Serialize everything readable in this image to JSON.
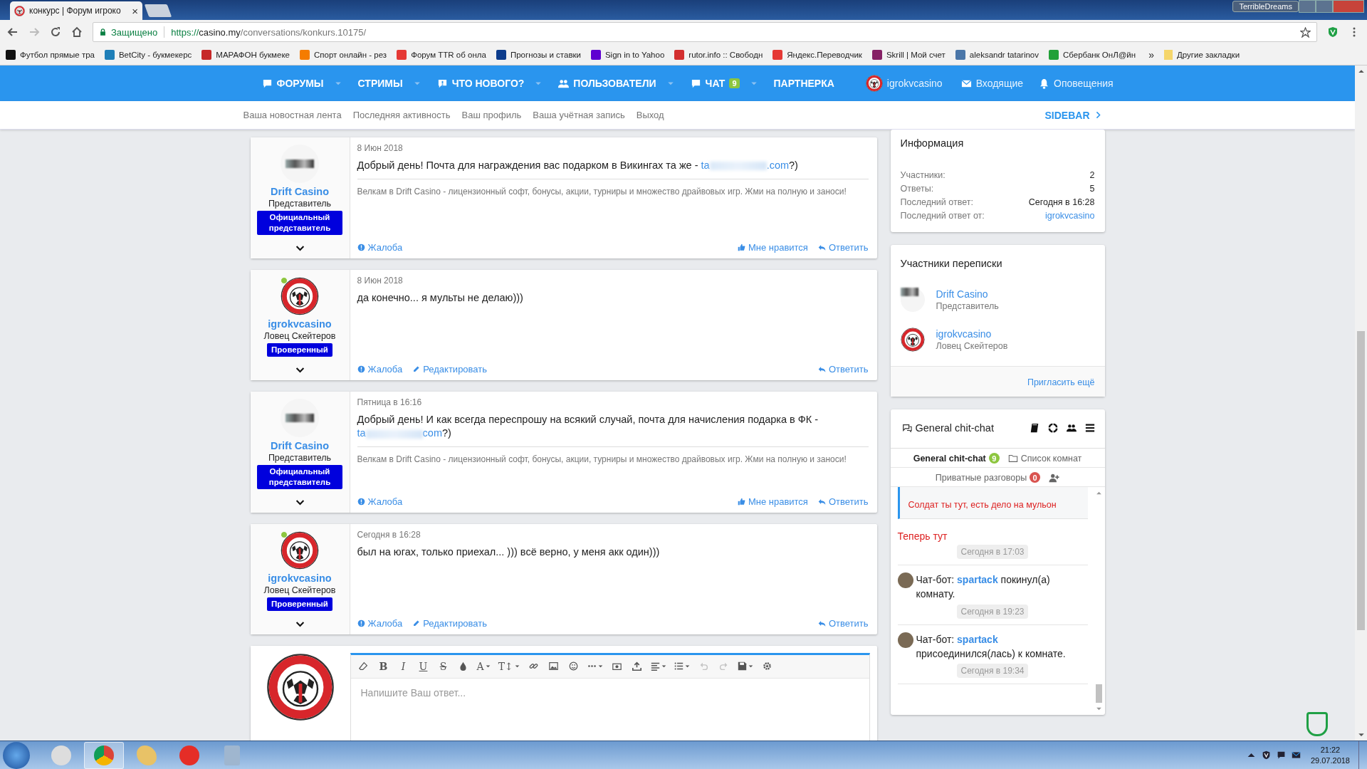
{
  "browser": {
    "tab": {
      "title": "конкурс | Форум игроко",
      "close": "×"
    },
    "user_label": "TerribleDreams",
    "security": "Защищено",
    "url": {
      "scheme": "https://",
      "host": "casino.my",
      "path": "/conversations/konkurs.10175/"
    }
  },
  "bookmarks": [
    {
      "label": "Футбол прямые тра",
      "color": "#111111"
    },
    {
      "label": "BetCity - букмекерс",
      "color": "#1f7fb8"
    },
    {
      "label": "МАРАФОН букмеке",
      "color": "#c62828"
    },
    {
      "label": "Спорт онлайн - рез",
      "color": "#f57c00"
    },
    {
      "label": "Форум TTR об онла",
      "color": "#e53935"
    },
    {
      "label": "Прогнозы и ставки",
      "color": "#0d3c8c"
    },
    {
      "label": "Sign in to Yahoo",
      "color": "#5f01d1"
    },
    {
      "label": "rutor.info :: Свободн",
      "color": "#d32f2f"
    },
    {
      "label": "Яндекс.Переводчик",
      "color": "#e53935"
    },
    {
      "label": "Skrill | Мой счет",
      "color": "#862165"
    },
    {
      "label": "aleksandr tatarinov",
      "color": "#4a76a8"
    },
    {
      "label": "Сбербанк ОнЛ@йн",
      "color": "#21a038"
    }
  ],
  "bookmarks_more": "»",
  "other_bookmarks": "Другие закладки",
  "nav": {
    "items": [
      {
        "label": "ФОРУМЫ",
        "caret": true
      },
      {
        "label": "СТРИМЫ",
        "caret": true
      },
      {
        "label": "ЧТО НОВОГО?",
        "caret": true
      },
      {
        "label": "ПОЛЬЗОВАТЕЛИ",
        "caret": true
      },
      {
        "label": "ЧАТ",
        "badge": "9",
        "caret": true
      },
      {
        "label": "ПАРТНЕРКА",
        "caret": false
      }
    ],
    "user": "igrokvcasino",
    "inbox": "Входящие",
    "alerts": "Оповещения"
  },
  "subnav": {
    "links": [
      "Ваша новостная лента",
      "Последняя активность",
      "Ваш профиль",
      "Ваша учётная запись",
      "Выход"
    ],
    "sidebar_toggle": "SIDEBAR"
  },
  "posts": [
    {
      "author": "Drift Casino",
      "kind": "representative",
      "online": false,
      "role": "Представитель",
      "badge": "Официальный представитель",
      "date": "8 Июн 2018",
      "text": "Добрый день! Почта для награждения вас подарком в Викингах та же - ",
      "link_start": "ta",
      "link_end": ".com",
      "tail": "?)",
      "signature": "Велкам в Drift Casino - лицензионный софт, бонусы, акции, турниры и множество драйвовых игр. Жми на полную и заноси!",
      "actions": [
        {
          "kind": "report",
          "label": "Жалоба"
        },
        {
          "kind": "like",
          "label": "Мне нравится"
        },
        {
          "kind": "reply",
          "label": "Ответить"
        }
      ]
    },
    {
      "author": "igrokvcasino",
      "kind": "member",
      "online": true,
      "role": "Ловец Скейтеров",
      "badge": "Проверенный",
      "date": "8 Июн 2018",
      "text": "да конечно... я мульты не делаю)))",
      "actions": [
        {
          "kind": "report",
          "label": "Жалоба"
        },
        {
          "kind": "edit",
          "label": "Редактировать"
        },
        {
          "kind": "reply",
          "label": "Ответить"
        }
      ]
    },
    {
      "author": "Drift Casino",
      "kind": "representative",
      "online": false,
      "role": "Представитель",
      "badge": "Официальный представитель",
      "date": "Пятница в 16:16",
      "text": "Добрый день! И как всегда переспрошу на всякий случай, почта для начисления подарка в ФК - ",
      "link_start": "ta",
      "link_end": "com",
      "tail": "?)",
      "signature": "Велкам в Drift Casino - лицензионный софт, бонусы, акции, турниры и множество драйвовых игр. Жми на полную и заноси!",
      "actions": [
        {
          "kind": "report",
          "label": "Жалоба"
        },
        {
          "kind": "like",
          "label": "Мне нравится"
        },
        {
          "kind": "reply",
          "label": "Ответить"
        }
      ]
    },
    {
      "author": "igrokvcasino",
      "kind": "member",
      "online": true,
      "role": "Ловец Скейтеров",
      "badge": "Проверенный",
      "date": "Сегодня в 16:28",
      "text": "был на югах, только приехал... ))) всё верно, у меня акк один)))",
      "actions": [
        {
          "kind": "report",
          "label": "Жалоба"
        },
        {
          "kind": "edit",
          "label": "Редактировать"
        },
        {
          "kind": "reply",
          "label": "Ответить"
        }
      ]
    }
  ],
  "editor": {
    "toolbar": [
      {
        "kind": "icon"
      },
      {
        "kind": "text",
        "label": "B"
      },
      {
        "kind": "text",
        "label": "I"
      },
      {
        "kind": "text",
        "label": "U"
      },
      {
        "kind": "text",
        "label": "S"
      },
      {
        "kind": "icon"
      },
      {
        "kind": "text",
        "label": "A",
        "caret": true
      },
      {
        "kind": "text",
        "label": "T↕",
        "caret": true
      },
      {
        "kind": "icon"
      },
      {
        "kind": "icon"
      },
      {
        "kind": "icon"
      },
      {
        "kind": "icon",
        "caret": true
      },
      {
        "kind": "icon"
      },
      {
        "kind": "icon"
      },
      {
        "kind": "icon",
        "caret": true
      },
      {
        "kind": "icon",
        "caret": true
      },
      {
        "kind": "icon",
        "disabled": true
      },
      {
        "kind": "icon",
        "disabled": true
      },
      {
        "kind": "icon",
        "caret": true
      },
      {
        "kind": "icon"
      }
    ],
    "placeholder": "Напишите Ваш ответ..."
  },
  "info": {
    "title": "Информация",
    "rows": [
      {
        "label": "Участники:",
        "value": "2",
        "kind": "plain"
      },
      {
        "label": "Ответы:",
        "value": "5",
        "kind": "plain"
      },
      {
        "label": "Последний ответ:",
        "value": "Сегодня в 16:28",
        "kind": "plain"
      },
      {
        "label": "Последний ответ от:",
        "value": "igrokvcasino",
        "kind": "link"
      }
    ]
  },
  "participants": {
    "title": "Участники переписки",
    "members": [
      {
        "name": "Drift Casino",
        "role": "Представитель",
        "kind": "representative"
      },
      {
        "name": "igrokvcasino",
        "role": "Ловец Скейтеров",
        "kind": "member"
      }
    ],
    "invite": "Пригласить ещё"
  },
  "chat": {
    "title": "General chit-chat",
    "tabs": [
      {
        "label": "General chit-chat",
        "badge": "9",
        "color": "#8dc63f",
        "selected": true
      },
      {
        "label": "Список комнат",
        "selected": false
      }
    ],
    "private": {
      "label": "Приватные разговоры",
      "badge": "0",
      "color": "#d9534f"
    },
    "quote": "Солдат ты тут, есть дело на мульон",
    "messages": [
      {
        "kind": "user",
        "text": "Теперь тут",
        "time": "Сегодня в 17:03"
      },
      {
        "kind": "bot",
        "prefix": "Чат-бот:",
        "user": "spartack",
        "text": "покинул(а) комнату.",
        "time": "Сегодня в 19:23"
      },
      {
        "kind": "bot",
        "prefix": "Чат-бот:",
        "user": "spartack",
        "text": "присоединился(лась) к комнате.",
        "time": "Сегодня в 19:34"
      }
    ]
  },
  "taskbar": {
    "apps": [
      {
        "selected": false
      },
      {
        "selected": true
      },
      {
        "selected": false
      },
      {
        "selected": false
      },
      {
        "selected": false
      }
    ],
    "time": "21:22",
    "date": "29.07.2018"
  }
}
